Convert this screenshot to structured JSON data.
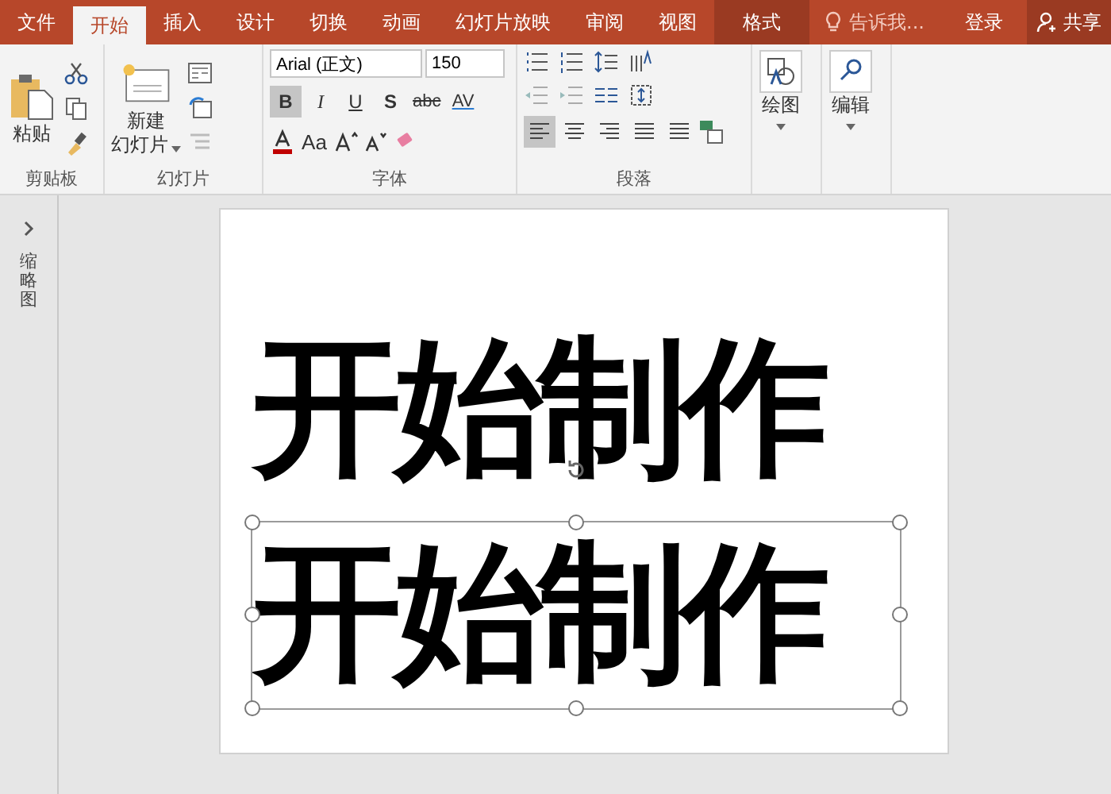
{
  "menu_tabs": [
    {
      "label": "文件",
      "selected": false,
      "kind": "normal"
    },
    {
      "label": "开始",
      "selected": true,
      "kind": "normal"
    },
    {
      "label": "插入",
      "selected": false,
      "kind": "normal"
    },
    {
      "label": "设计",
      "selected": false,
      "kind": "normal"
    },
    {
      "label": "切换",
      "selected": false,
      "kind": "normal"
    },
    {
      "label": "动画",
      "selected": false,
      "kind": "normal"
    },
    {
      "label": "幻灯片放映",
      "selected": false,
      "kind": "normal"
    },
    {
      "label": "审阅",
      "selected": false,
      "kind": "normal"
    },
    {
      "label": "视图",
      "selected": false,
      "kind": "normal"
    },
    {
      "label": "格式",
      "selected": false,
      "kind": "contextual"
    }
  ],
  "tell_me": {
    "placeholder": "告诉我..."
  },
  "sign_in": "登录",
  "share": "共享",
  "ribbon": {
    "clipboard": {
      "paste": "粘贴",
      "label": "剪贴板"
    },
    "slides": {
      "new_slide_top": "新建",
      "new_slide_bottom": "幻灯片",
      "label": "幻灯片"
    },
    "font": {
      "font_name": "Arial (正文)",
      "font_size": "150",
      "label": "字体",
      "format_buttons": [
        {
          "label": "B",
          "selected": true
        },
        {
          "label": "I",
          "selected": false
        },
        {
          "label": "U",
          "selected": false
        },
        {
          "label": "S",
          "selected": false
        },
        {
          "label": "abc",
          "selected": false
        },
        {
          "label": "AV",
          "selected": false
        }
      ],
      "case_button": "Aa"
    },
    "paragraph": {
      "label": "段落",
      "align_buttons": [
        {
          "selected": true
        },
        {
          "selected": false
        },
        {
          "selected": false
        },
        {
          "selected": false
        },
        {
          "selected": false
        }
      ]
    },
    "drawing": {
      "label": "绘图"
    },
    "editing": {
      "label": "编辑"
    }
  },
  "sidebar": {
    "label": "缩略图"
  },
  "slide": {
    "text_boxes": [
      {
        "text": "开始制作",
        "selected": false
      },
      {
        "text": "开始制作",
        "selected": true
      }
    ]
  }
}
